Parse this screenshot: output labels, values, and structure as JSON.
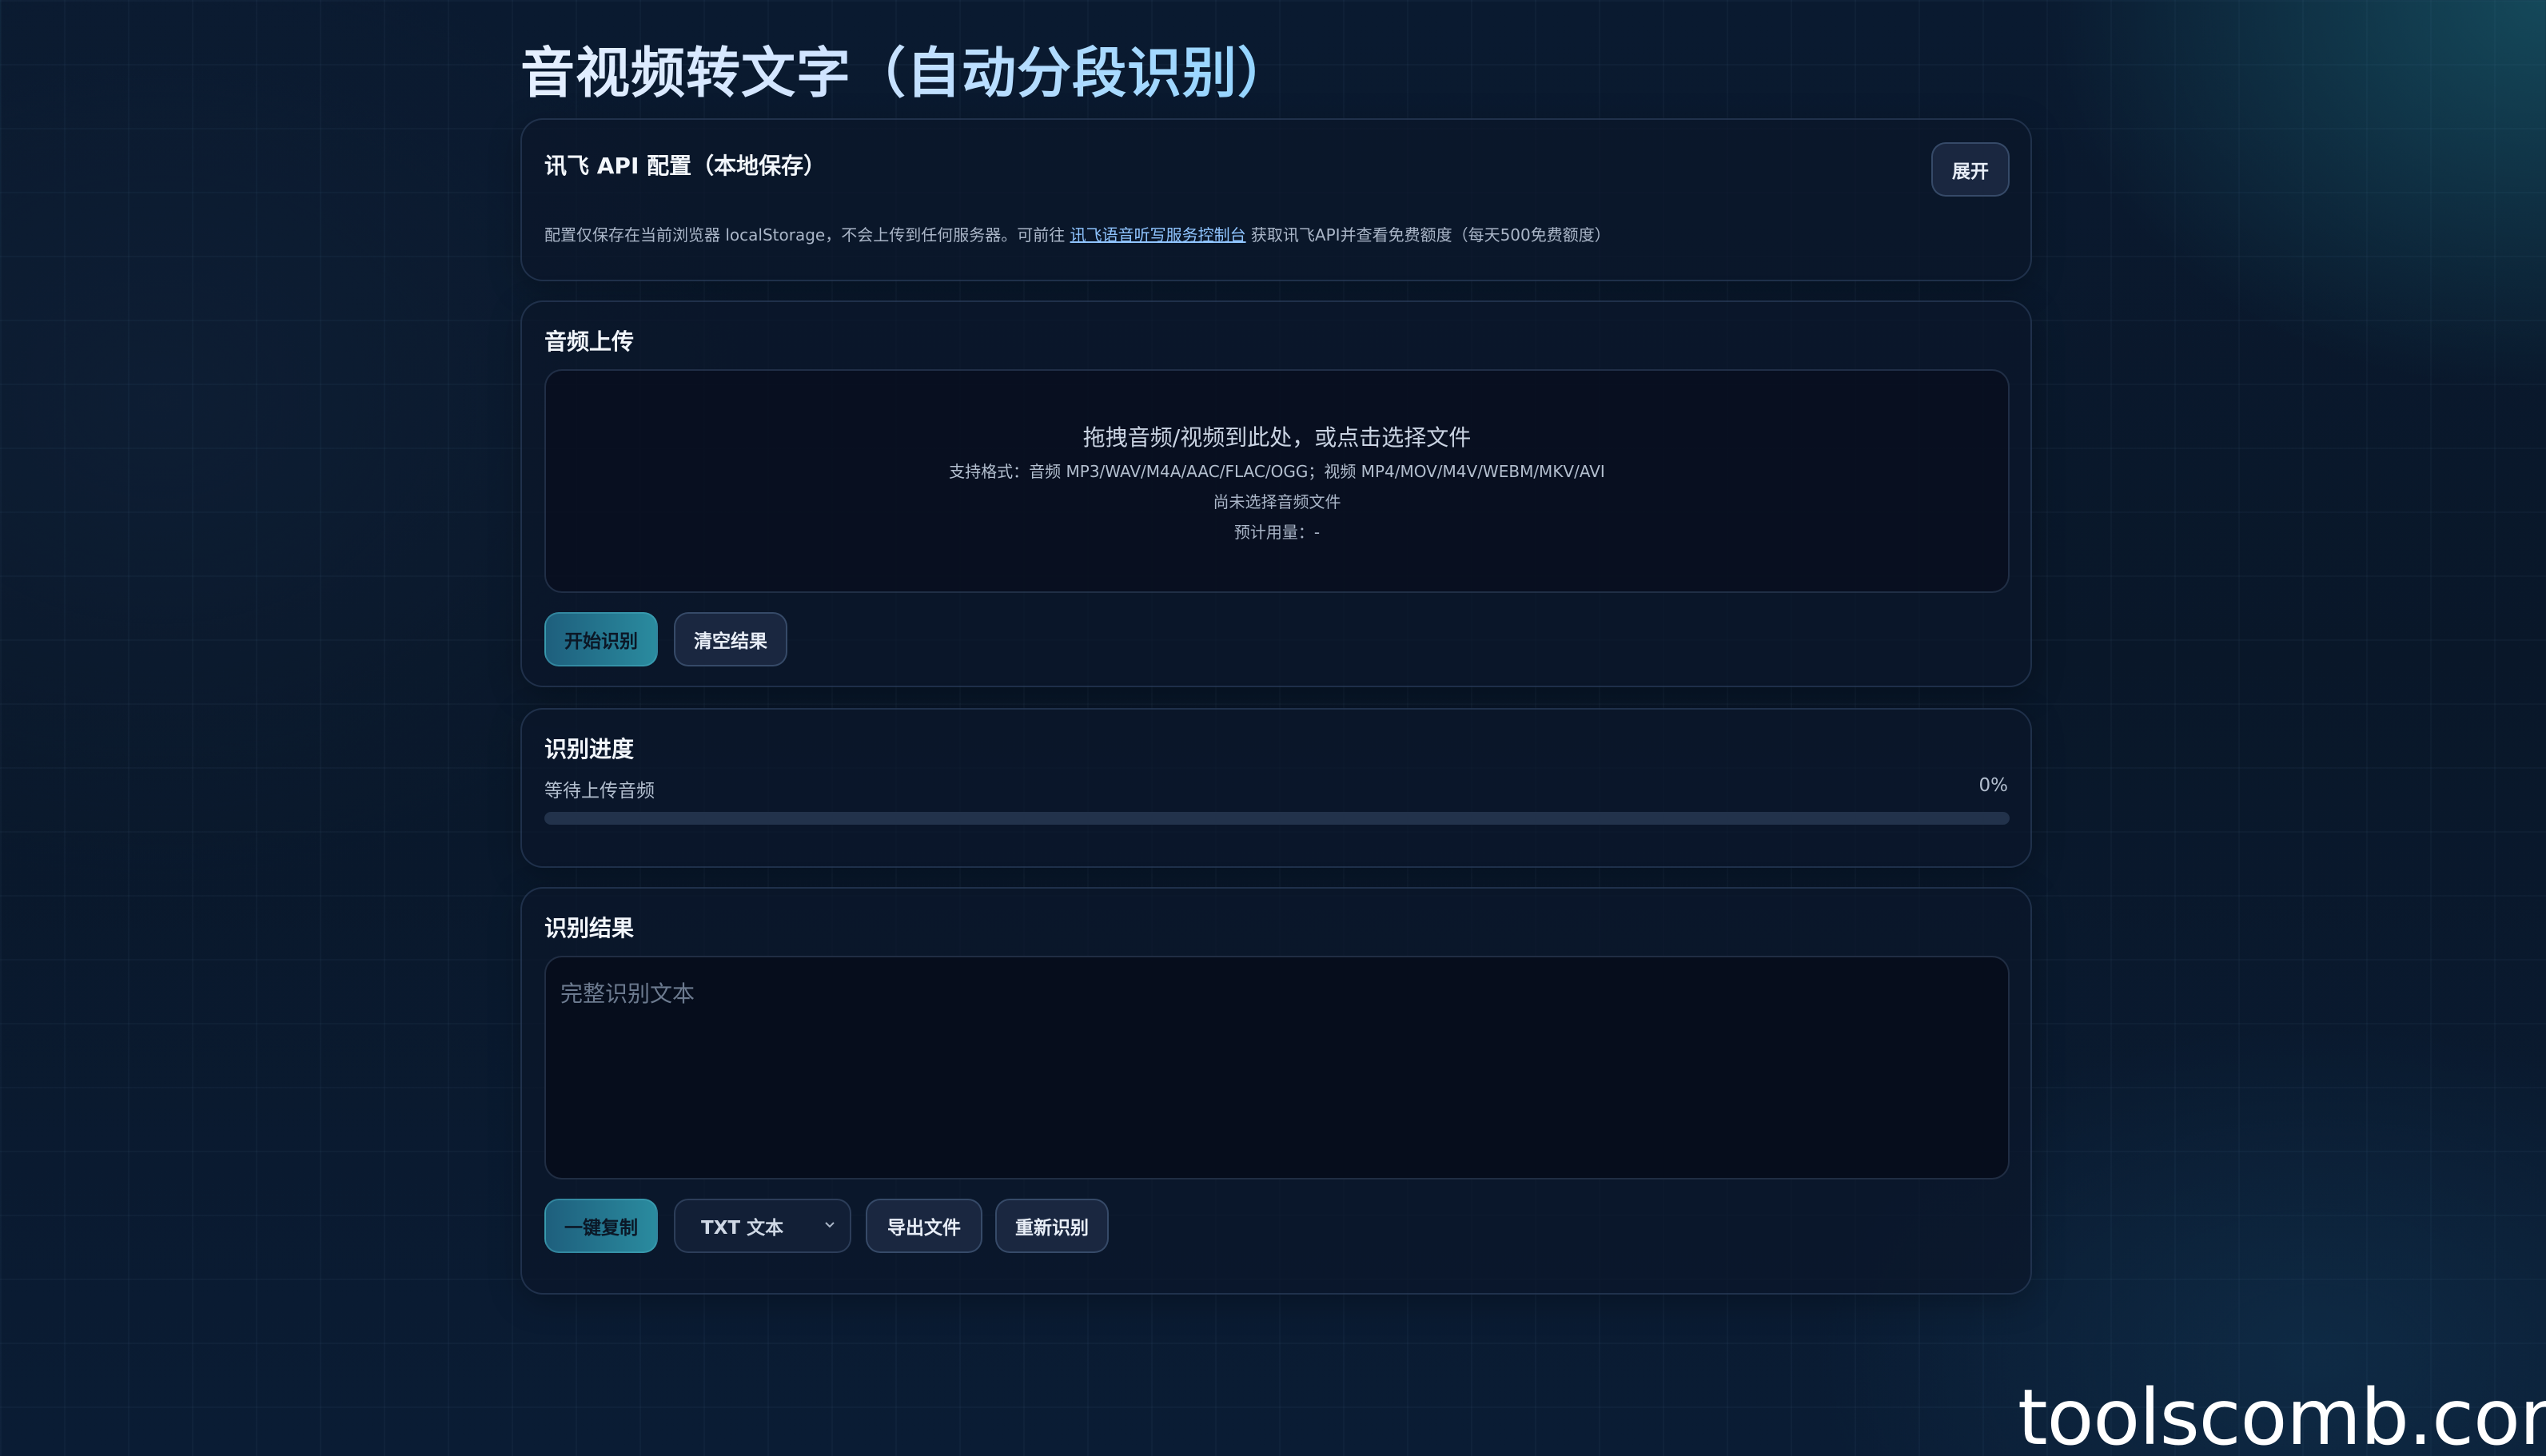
{
  "page": {
    "title": "音视频转文字（自动分段识别）"
  },
  "config": {
    "title": "讯飞 API 配置（本地保存）",
    "toggle_label": "展开",
    "note_before": "配置仅保存在当前浏览器 localStorage，不会上传到任何服务器。可前往 ",
    "note_link": "讯飞语音听写服务控制台",
    "note_after": " 获取讯飞API并查看免费额度（每天500免费额度）"
  },
  "upload": {
    "title": "音频上传",
    "drop_hint": "拖拽音频/视频到此处，或点击选择文件",
    "formats": "支持格式：音频 MP3/WAV/M4A/AAC/FLAC/OGG；视频 MP4/MOV/M4V/WEBM/MKV/AVI",
    "file_status": "尚未选择音频文件",
    "usage": "预计用量：-",
    "start_label": "开始识别",
    "clear_label": "清空结果"
  },
  "progress": {
    "title": "识别进度",
    "status": "等待上传音频",
    "percent_text": "0%",
    "fraction": 0
  },
  "result": {
    "title": "识别结果",
    "placeholder": "完整识别文本",
    "value": "",
    "copy_label": "一键复制",
    "format_selected": "TXT 文本",
    "export_label": "导出文件",
    "retry_label": "重新识别"
  },
  "watermark": "toolscomb.com",
  "colors": {
    "background": "#0a1a30",
    "accent": "#2a8b9f",
    "link": "#8fc4ff"
  }
}
